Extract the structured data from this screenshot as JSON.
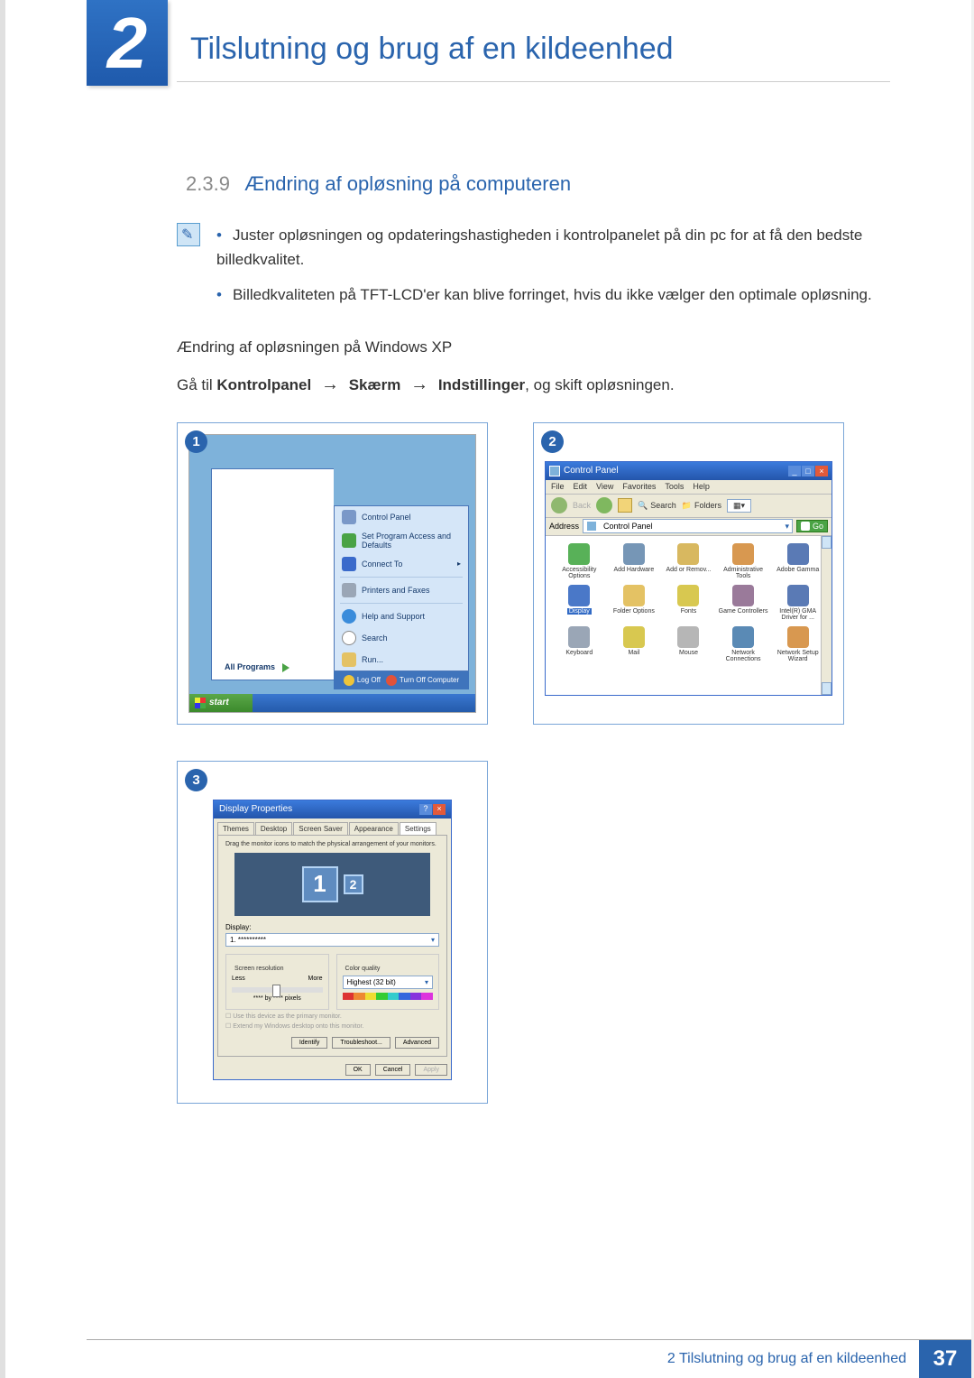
{
  "header": {
    "chapter_num": "2",
    "chapter_title": "Tilslutning og brug af en kildeenhed"
  },
  "section": {
    "number": "2.3.9",
    "title": "Ændring af opløsning på computeren"
  },
  "info": {
    "bullet1": "Juster opløsningen og opdateringshastigheden i kontrolpanelet på din pc for at få den bedste billedkvalitet.",
    "bullet2": "Billedkvaliteten på TFT-LCD'er kan blive forringet, hvis du ikke vælger den optimale opløsning."
  },
  "subheading": "Ændring af opløsningen på Windows XP",
  "instruction": {
    "prefix": "Gå til ",
    "step1": "Kontrolpanel",
    "step2": "Skærm",
    "step3": "Indstillinger",
    "suffix": ", og skift opløsningen."
  },
  "badges": {
    "b1": "1",
    "b2": "2",
    "b3": "3"
  },
  "shot1": {
    "items": {
      "cp": "Control Panel",
      "spa": "Set Program Access and Defaults",
      "conn": "Connect To",
      "pf": "Printers and Faxes",
      "hs": "Help and Support",
      "search": "Search",
      "run": "Run..."
    },
    "all_programs": "All Programs",
    "logoff": "Log Off",
    "turnoff": "Turn Off Computer",
    "start": "start"
  },
  "shot2": {
    "title": "Control Panel",
    "menu": {
      "file": "File",
      "edit": "Edit",
      "view": "View",
      "fav": "Favorites",
      "tools": "Tools",
      "help": "Help"
    },
    "toolbar": {
      "back": "Back",
      "search": "Search",
      "folders": "Folders"
    },
    "address_lbl": "Address",
    "address_val": "Control Panel",
    "go": "Go",
    "items": [
      {
        "lbl": "Accessibility Options",
        "c": "#58b158"
      },
      {
        "lbl": "Add Hardware",
        "c": "#7696b6"
      },
      {
        "lbl": "Add or Remov...",
        "c": "#d8b860"
      },
      {
        "lbl": "Administrative Tools",
        "c": "#d89850"
      },
      {
        "lbl": "Adobe Gamma",
        "c": "#5a7ab5"
      },
      {
        "lbl": "Display",
        "c": "#4a78c8",
        "sel": true
      },
      {
        "lbl": "Folder Options",
        "c": "#e4c264"
      },
      {
        "lbl": "Fonts",
        "c": "#d8c850"
      },
      {
        "lbl": "Game Controllers",
        "c": "#9a7a9a"
      },
      {
        "lbl": "Intel(R) GMA Driver for ...",
        "c": "#5a7ab5"
      },
      {
        "lbl": "Keyboard",
        "c": "#9aa6b6"
      },
      {
        "lbl": "Mail",
        "c": "#d8c850"
      },
      {
        "lbl": "Mouse",
        "c": "#b6b6b6"
      },
      {
        "lbl": "Network Connections",
        "c": "#5a8ab5"
      },
      {
        "lbl": "Network Setup Wizard",
        "c": "#d89850"
      }
    ]
  },
  "shot3": {
    "title": "Display Properties",
    "tabs": {
      "themes": "Themes",
      "desktop": "Desktop",
      "ss": "Screen Saver",
      "app": "Appearance",
      "settings": "Settings"
    },
    "hint": "Drag the monitor icons to match the physical arrangement of your monitors.",
    "mon1": "1",
    "mon2": "2",
    "display_lbl": "Display:",
    "display_val": "1. **********",
    "res_group": "Screen resolution",
    "less": "Less",
    "more": "More",
    "res_val": "**** by **** pixels",
    "col_group": "Color quality",
    "col_val": "Highest (32 bit)",
    "chk1": "Use this device as the primary monitor.",
    "chk2": "Extend my Windows desktop onto this monitor.",
    "identify": "Identify",
    "troubleshoot": "Troubleshoot...",
    "advanced": "Advanced",
    "ok": "OK",
    "cancel": "Cancel",
    "apply": "Apply"
  },
  "footer": {
    "text": "2 Tilslutning og brug af en kildeenhed",
    "page": "37"
  }
}
